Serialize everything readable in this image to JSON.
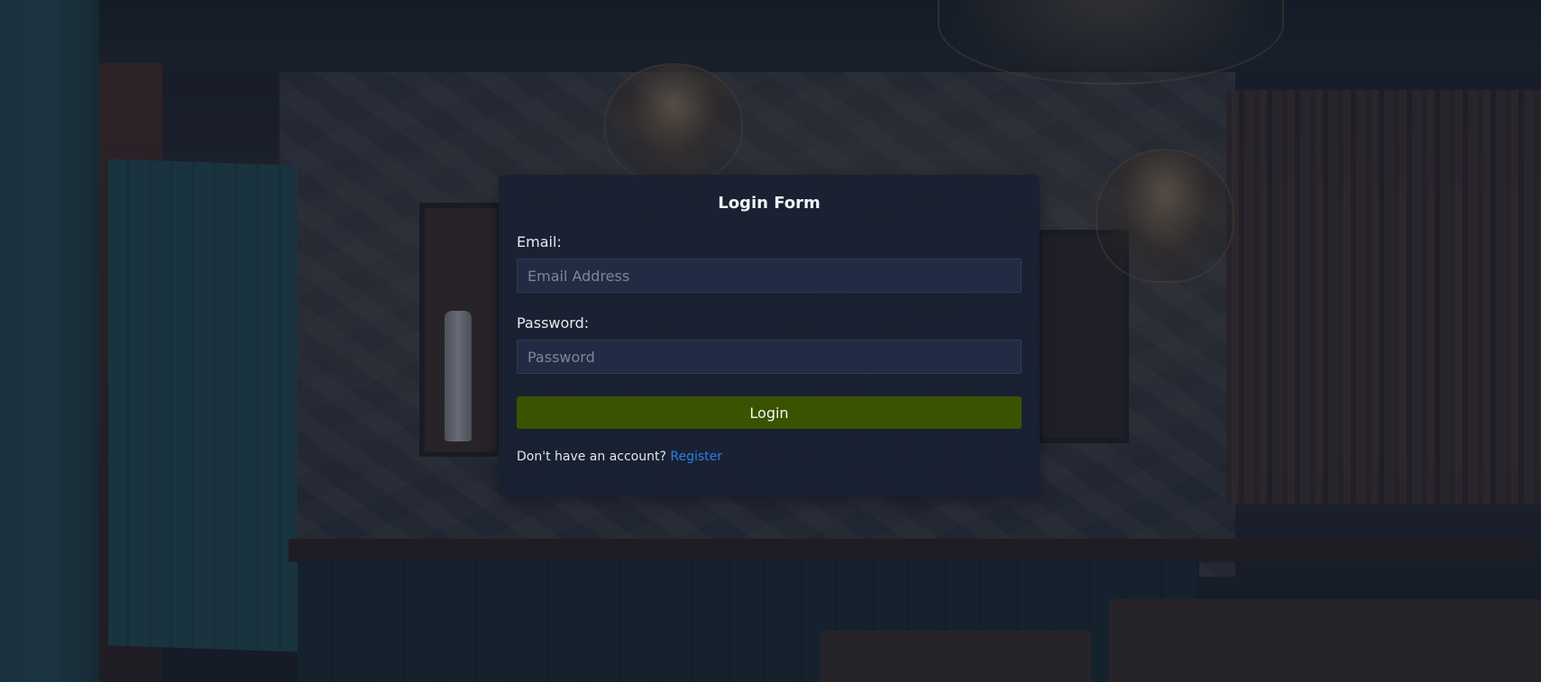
{
  "login_form": {
    "title": "Login Form",
    "email_label": "Email:",
    "email_placeholder": "Email Address",
    "email_value": "",
    "password_label": "Password:",
    "password_placeholder": "Password",
    "password_value": "",
    "login_button_label": "Login",
    "register_prompt": "Don't have an account?",
    "register_link_label": "Register"
  },
  "colors": {
    "card_background": "#182031",
    "input_background": "#222b43",
    "login_button": "#3a5300",
    "link": "#2f7bf0"
  }
}
